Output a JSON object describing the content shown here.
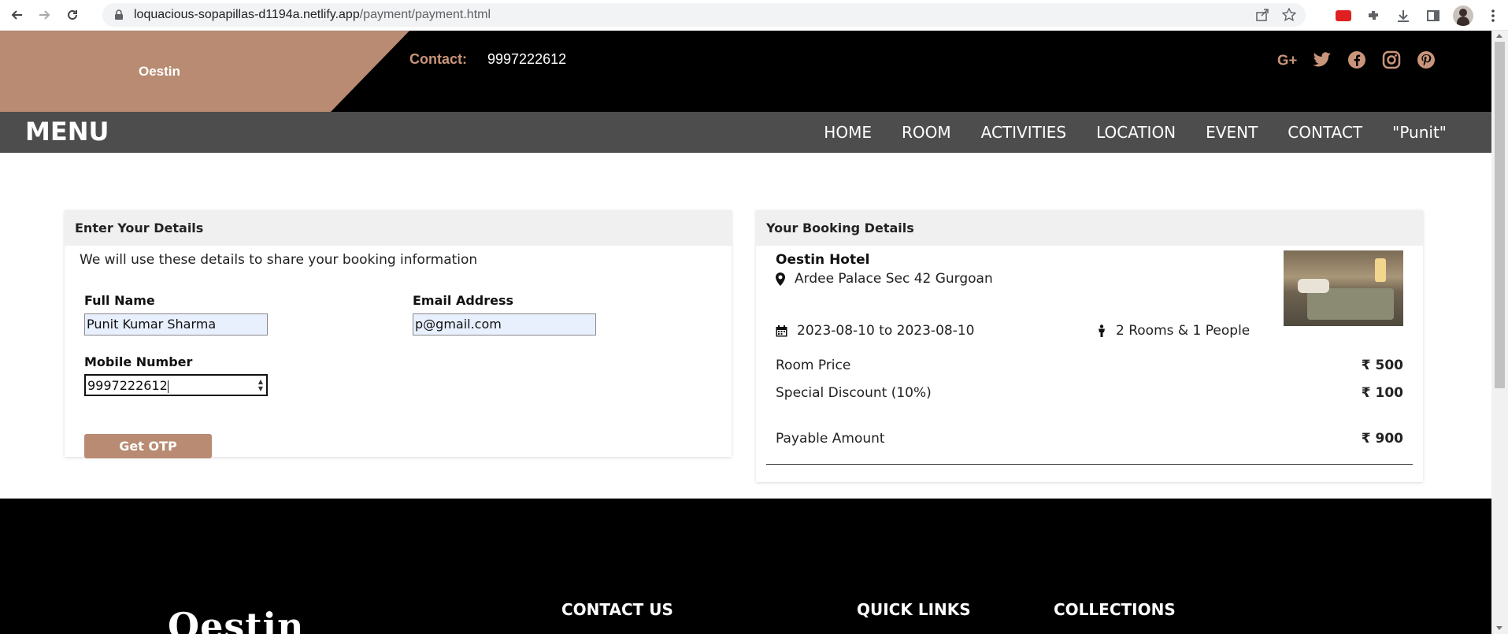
{
  "browser": {
    "url_host": "loquacious-sopapillas-d1194a.netlify.app",
    "url_path": "/payment/payment.html"
  },
  "site": {
    "brand": "Oestin",
    "contact_label": "Contact:",
    "contact_value": "9997222612",
    "menu_title": "MENU",
    "nav": [
      "HOME",
      "ROOM",
      "ACTIVITIES",
      "LOCATION",
      "EVENT",
      "CONTACT",
      "\"Punit\""
    ],
    "accent_color": "#b88b72"
  },
  "details": {
    "title": "Enter Your Details",
    "subtitle": "We will use these details to share your booking information",
    "full_name_label": "Full Name",
    "full_name_value": "Punit Kumar Sharma",
    "email_label": "Email Address",
    "email_value": "p@gmail.com",
    "mobile_label": "Mobile Number",
    "mobile_value": "9997222612",
    "otp_button": "Get OTP"
  },
  "booking": {
    "title": "Your Booking Details",
    "hotel_name": "Oestin Hotel",
    "address": "Ardee Palace Sec 42 Gurgoan",
    "dates": "2023-08-10 to 2023-08-10",
    "rooms": "2 Rooms & 1 People",
    "room_price_label": "Room Price",
    "room_price": "₹ 500",
    "discount_label": "Special Discount (10%)",
    "discount": "₹ 100",
    "payable_label": "Payable Amount",
    "payable": "₹ 900"
  },
  "footer": {
    "logo": "Oestin",
    "contact_heading": "CONTACT US",
    "links_heading": "QUICK LINKS",
    "collections_heading": "COLLECTIONS"
  }
}
